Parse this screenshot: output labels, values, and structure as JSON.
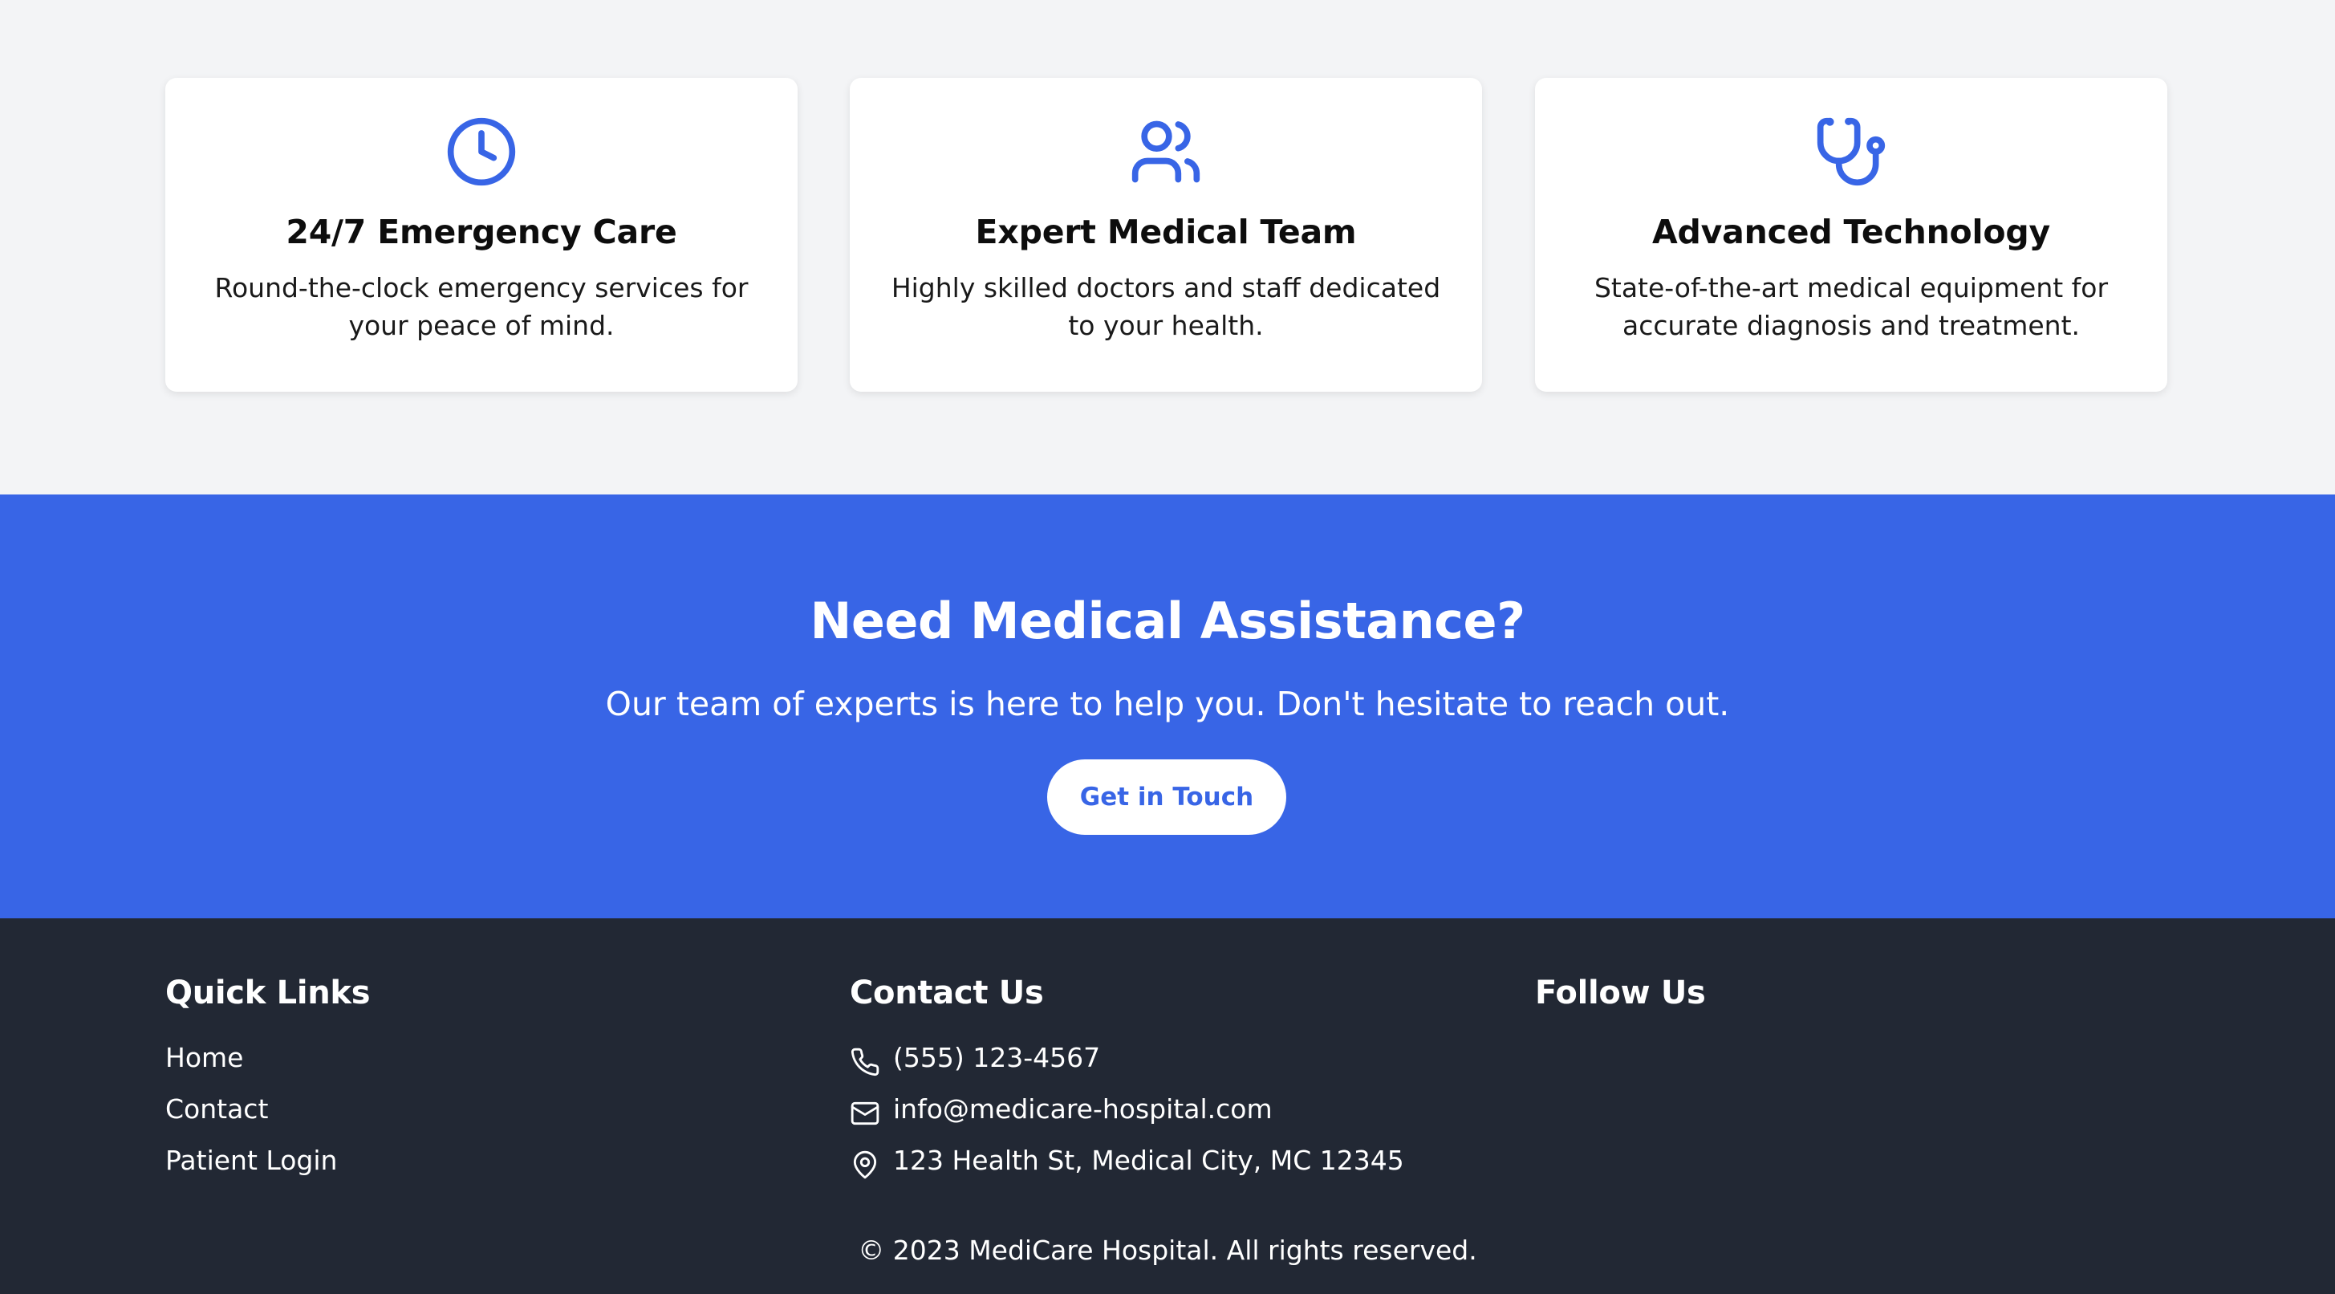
{
  "features": [
    {
      "icon": "clock-icon",
      "title": "24/7 Emergency Care",
      "description": "Round-the-clock emergency services for your peace of mind."
    },
    {
      "icon": "users-icon",
      "title": "Expert Medical Team",
      "description": "Highly skilled doctors and staff dedicated to your health."
    },
    {
      "icon": "stethoscope-icon",
      "title": "Advanced Technology",
      "description": "State-of-the-art medical equipment for accurate diagnosis and treatment."
    }
  ],
  "cta": {
    "heading": "Need Medical Assistance?",
    "text": "Our team of experts is here to help you. Don't hesitate to reach out.",
    "button_label": "Get in Touch"
  },
  "footer": {
    "quick_links": {
      "heading": "Quick Links",
      "items": [
        "Home",
        "Contact",
        "Patient Login"
      ]
    },
    "contact": {
      "heading": "Contact Us",
      "phone": "(555) 123-4567",
      "email": "info@medicare-hospital.com",
      "address": "123 Health St, Medical City, MC 12345"
    },
    "follow": {
      "heading": "Follow Us"
    },
    "copyright": "© 2023 MediCare Hospital. All rights reserved."
  },
  "colors": {
    "accent": "#3865e6",
    "footer_bg": "#222834",
    "page_bg": "#f3f4f6"
  }
}
